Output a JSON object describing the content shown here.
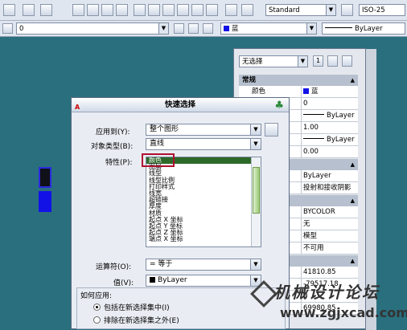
{
  "toolbar": {
    "text_style": "Standard",
    "dim_style": "ISO-25",
    "layer": "0",
    "color": "蓝",
    "linetype": "ByLayer"
  },
  "palette": {
    "selection": "无选择",
    "count": "1",
    "sections": [
      "常规"
    ],
    "rows": [
      {
        "key": "颜色",
        "value": "蓝"
      },
      {
        "key": "",
        "value": "0"
      },
      {
        "key": "",
        "value": "ByLayer"
      },
      {
        "key": "",
        "value": "1.00"
      },
      {
        "key": "",
        "value": "ByLayer"
      },
      {
        "key": "",
        "value": "0.00"
      },
      {
        "key": "",
        "value": ""
      },
      {
        "key": "",
        "value": "ByLayer"
      },
      {
        "key": "",
        "value": "投射和接收阴影"
      },
      {
        "key": "",
        "value": ""
      },
      {
        "key": "",
        "value": "BYCOLOR"
      },
      {
        "key": "",
        "value": "无"
      },
      {
        "key": "",
        "value": "模型"
      },
      {
        "key": "",
        "value": "不可用"
      },
      {
        "key": "",
        "value": ""
      },
      {
        "key": "",
        "value": "41810.85"
      },
      {
        "key": "",
        "value": "-79517.18"
      },
      {
        "key": "",
        "value": "0"
      },
      {
        "key": "",
        "value": "69980.85"
      }
    ]
  },
  "dialog": {
    "title": "快速选择",
    "apply_to_label": "应用到(Y):",
    "apply_to_value": "整个图形",
    "object_type_label": "对象类型(B):",
    "object_type_value": "直线",
    "properties_label": "特性(P):",
    "properties": [
      "颜色",
      "图层",
      "线型",
      "线型比例",
      "打印样式",
      "线宽",
      "超链接",
      "厚度",
      "材质",
      "起点 X 坐标",
      "起点 Y 坐标",
      "起点 Z 坐标",
      "端点 X 坐标"
    ],
    "selected_property": "颜色",
    "operator_label": "运算符(O):",
    "operator_value": "= 等于",
    "value_label": "值(V):",
    "value_value": "ByLayer",
    "how_to_apply": "如何应用:",
    "option_include": "包括在新选择集中(I)",
    "option_exclude": "排除在新选择集之外(E)"
  },
  "watermark": {
    "line1": "机械设计论坛",
    "line2": "www.zgjxcad.com"
  },
  "colors": {
    "canvas": "#2a6f7e",
    "selection_highlight": "#2d6a2a",
    "callout_border": "#b01030",
    "blue_swatch": "#1212e6"
  }
}
